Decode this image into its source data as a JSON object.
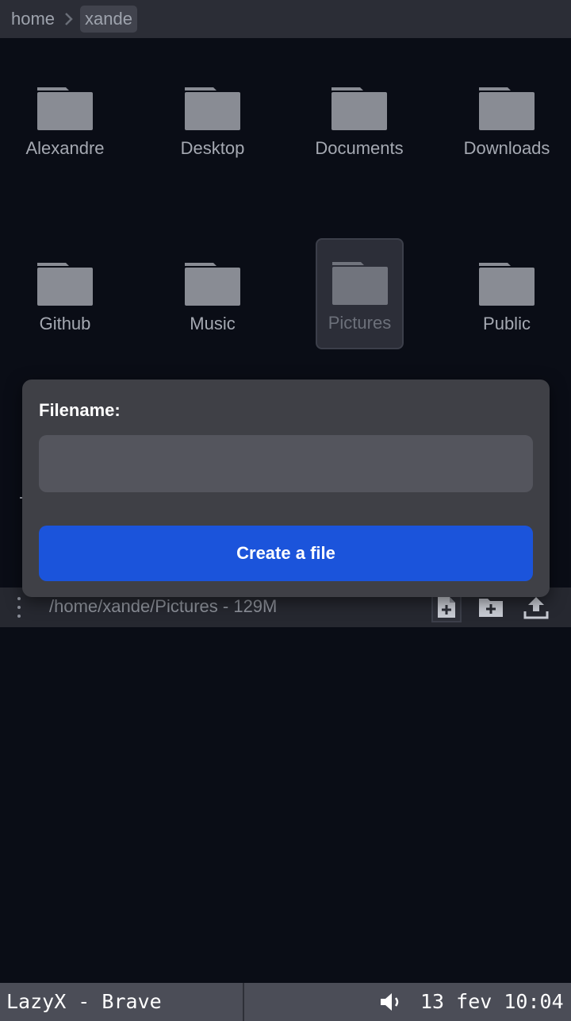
{
  "breadcrumb": {
    "items": [
      "home",
      "xande"
    ]
  },
  "folders": [
    {
      "name": "Alexandre"
    },
    {
      "name": "Desktop"
    },
    {
      "name": "Documents"
    },
    {
      "name": "Downloads"
    },
    {
      "name": "Github"
    },
    {
      "name": "Music"
    },
    {
      "name": "Pictures"
    },
    {
      "name": "Public"
    }
  ],
  "pathbar": {
    "path": "/home/xande/Pictures - 129M"
  },
  "dialog": {
    "label": "Filename:",
    "input_value": "",
    "button": "Create a file"
  },
  "taskbar": {
    "title": "LazyX - Brave",
    "clock": "13 fev 10:04"
  },
  "colors": {
    "accent": "#1b54db",
    "background": "#0a0d16",
    "folder": "#898c94"
  },
  "icons": {
    "breadcrumb_sep": "chevron-right-icon",
    "folder": "folder-icon",
    "menu": "kebab-menu-icon",
    "new_file": "new-file-icon",
    "new_folder": "new-folder-icon",
    "upload": "upload-icon",
    "volume": "volume-icon"
  }
}
